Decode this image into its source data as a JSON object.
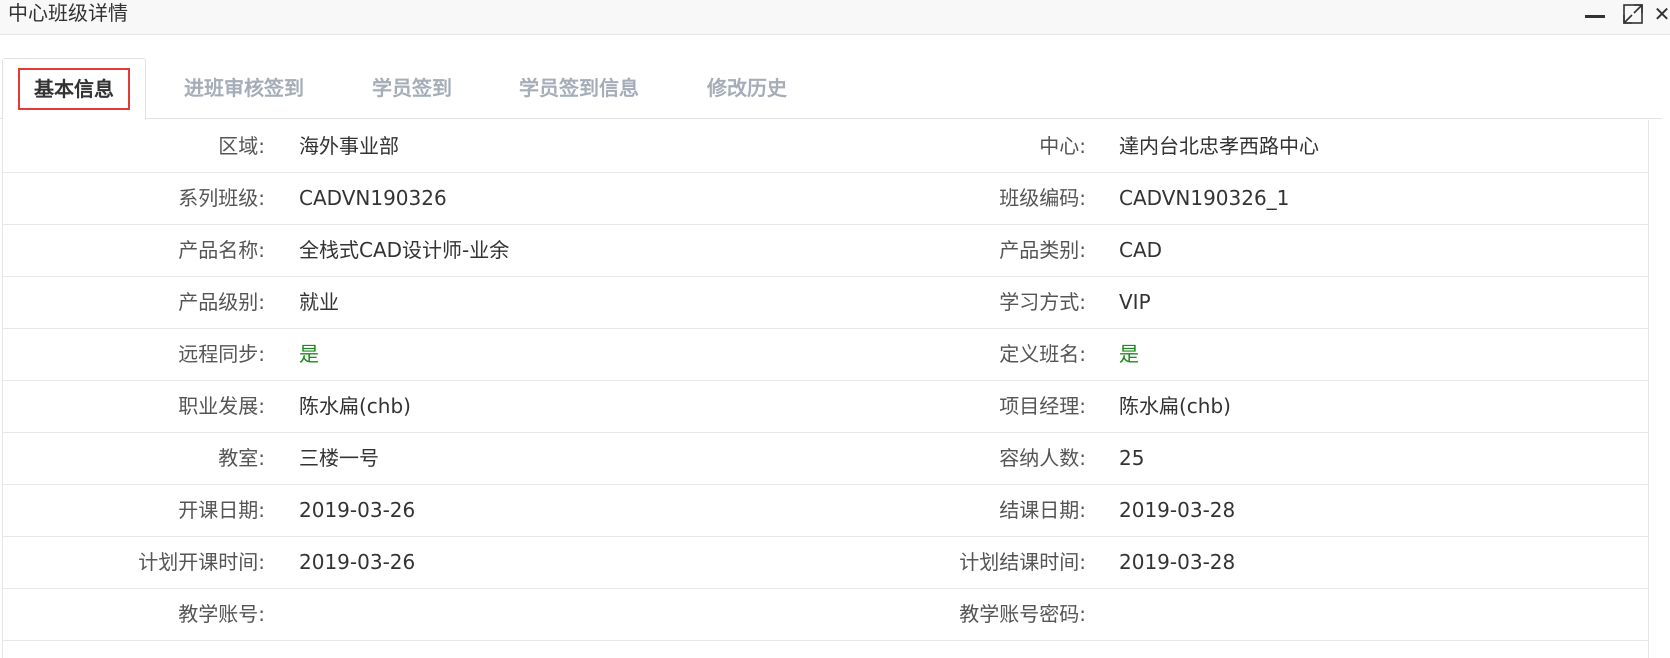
{
  "window": {
    "title": "中心班级详情",
    "controls": [
      "minimize-icon",
      "maximize-icon",
      "close-icon"
    ]
  },
  "tabs": [
    {
      "label": "基本信息",
      "active": true
    },
    {
      "label": "进班审核签到",
      "active": false
    },
    {
      "label": "学员签到",
      "active": false
    },
    {
      "label": "学员签到信息",
      "active": false
    },
    {
      "label": "修改历史",
      "active": false
    }
  ],
  "info": {
    "rows": [
      {
        "left_label": "区域:",
        "left_value": "海外事业部",
        "right_label": "中心:",
        "right_value": "達内台北忠孝西路中心"
      },
      {
        "left_label": "系列班级:",
        "left_value": "CADVN190326",
        "right_label": "班级编码:",
        "right_value": "CADVN190326_1"
      },
      {
        "left_label": "产品名称:",
        "left_value": "全栈式CAD设计师-业余",
        "right_label": "产品类别:",
        "right_value": "CAD"
      },
      {
        "left_label": "产品级别:",
        "left_value": "就业",
        "right_label": "学习方式:",
        "right_value": "VIP"
      },
      {
        "left_label": "远程同步:",
        "left_value": "是",
        "right_label": "定义班名:",
        "right_value": "是"
      },
      {
        "left_label": "职业发展:",
        "left_value": "陈水扁(chb)",
        "right_label": "项目经理:",
        "right_value": "陈水扁(chb)"
      },
      {
        "left_label": "教室:",
        "left_value": "三楼一号",
        "right_label": "容纳人数:",
        "right_value": "25"
      },
      {
        "left_label": "开课日期:",
        "left_value": "2019-03-26",
        "right_label": "结课日期:",
        "right_value": "2019-03-28"
      },
      {
        "left_label": "计划开课时间:",
        "left_value": "2019-03-26",
        "right_label": "计划结课时间:",
        "right_value": "2019-03-28"
      },
      {
        "left_label": "教学账号:",
        "left_value": "",
        "right_label": "教学账号密码:",
        "right_value": ""
      }
    ]
  },
  "colors": {
    "active_tab_outline": "#e53935",
    "inactive_tab_text": "#a6adb8",
    "yes_value": "#1a8a1a"
  }
}
